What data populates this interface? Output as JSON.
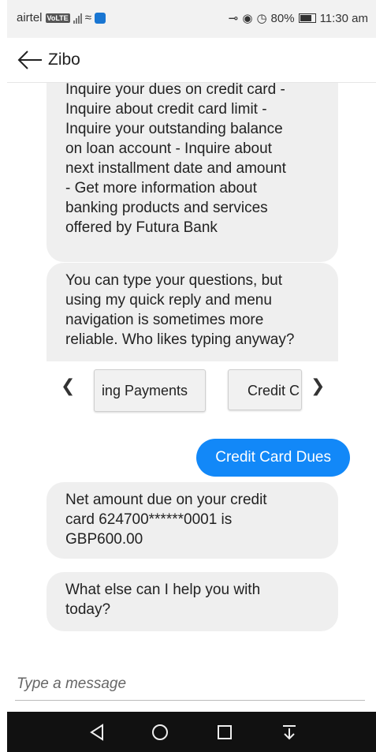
{
  "status_bar": {
    "carrier": "airtel",
    "volte": "VoLTE",
    "battery": "80%",
    "time": "11:30 am"
  },
  "header": {
    "title": "Zibo"
  },
  "messages": {
    "bot_1": "Inquire your dues on credit card -\nInquire about credit card limit -\nInquire your outstanding balance\non loan account - Inquire about\nnext installment date and amount\n- Get more information about\nbanking products and services\noffered by Futura Bank",
    "bot_2": "You can type your questions, but\nusing my quick reply and menu\nnavigation is sometimes more\nreliable. Who likes typing anyway?",
    "user_1": "Credit Card Dues",
    "bot_3": "Net amount due on your credit\ncard 624700******0001 is\nGBP600.00",
    "bot_4": "What else can I help you with\ntoday?"
  },
  "carousel": {
    "chips": [
      "ing Payments",
      "Credit C"
    ]
  },
  "input": {
    "placeholder": "Type a message"
  },
  "colors": {
    "user_bubble": "#1288f8",
    "bot_bubble": "#efefef"
  },
  "icons": [
    "back-arrow-icon",
    "carousel-prev-icon",
    "carousel-next-icon",
    "nav-back-icon",
    "nav-home-icon",
    "nav-recents-icon",
    "nav-notifications-icon"
  ]
}
